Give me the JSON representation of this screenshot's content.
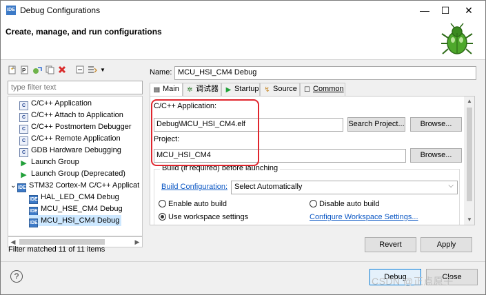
{
  "window": {
    "title": "Debug Configurations",
    "icon_label": "IDE",
    "minimize_glyph": "—",
    "maximize_glyph": "☐",
    "close_glyph": "✕"
  },
  "banner": {
    "title": "Create, manage, and run configurations"
  },
  "left": {
    "filter_placeholder": "type filter text",
    "tree": [
      {
        "label": "C/C++ Application",
        "icon": "C"
      },
      {
        "label": "C/C++ Attach to Application",
        "icon": "C"
      },
      {
        "label": "C/C++ Postmortem Debugger",
        "icon": "C"
      },
      {
        "label": "C/C++ Remote Application",
        "icon": "C"
      },
      {
        "label": "GDB Hardware Debugging",
        "icon": "C"
      },
      {
        "label": "Launch Group",
        "icon": "▶"
      },
      {
        "label": "Launch Group (Deprecated)",
        "icon": "▶"
      },
      {
        "label": "STM32 Cortex-M C/C++ Applicat",
        "icon": "IDE",
        "expand": "⌄"
      },
      {
        "label": "HAL_LED_CM4 Debug",
        "icon": "IDE"
      },
      {
        "label": "MCU_HSE_CM4 Debug",
        "icon": "IDE"
      },
      {
        "label": "MCU_HSI_CM4 Debug",
        "icon": "IDE"
      }
    ],
    "filter_status": "Filter matched 11 of 11 items"
  },
  "right": {
    "name_label": "Name:",
    "name_value": "MCU_HSI_CM4 Debug",
    "tabs": [
      {
        "label": "Main",
        "icon": "▤"
      },
      {
        "label": "调试器",
        "icon": "✲"
      },
      {
        "label": "Startup",
        "icon": "▶"
      },
      {
        "label": "Source",
        "icon": "↯"
      },
      {
        "label": "Common",
        "icon": "☐"
      }
    ],
    "c_app_label": "C/C++ Application:",
    "c_app_value": "Debug\\MCU_HSI_CM4.elf",
    "search_project_button": "Search Project...",
    "browse_button_1": "Browse...",
    "project_label": "Project:",
    "project_value": "MCU_HSI_CM4",
    "browse_button_2": "Browse...",
    "build_group_title": "Build (if required) before launching",
    "build_config_link": "Build Configuration:",
    "build_config_value": "Select Automatically",
    "enable_auto_build": "Enable auto build",
    "disable_auto_build": "Disable auto build",
    "use_workspace_settings": "Use workspace settings",
    "configure_workspace_link": "Configure Workspace Settings...",
    "revert_button": "Revert",
    "apply_button": "Apply"
  },
  "footer": {
    "help_glyph": "?",
    "debug_button": "Debug",
    "close_button": "Close",
    "watermark": "CSDN @正点原子"
  },
  "colors": {
    "accent": "#3d7ac7",
    "highlight": "#e0252d",
    "link": "#0b57c4",
    "selection": "#cde8ff"
  }
}
